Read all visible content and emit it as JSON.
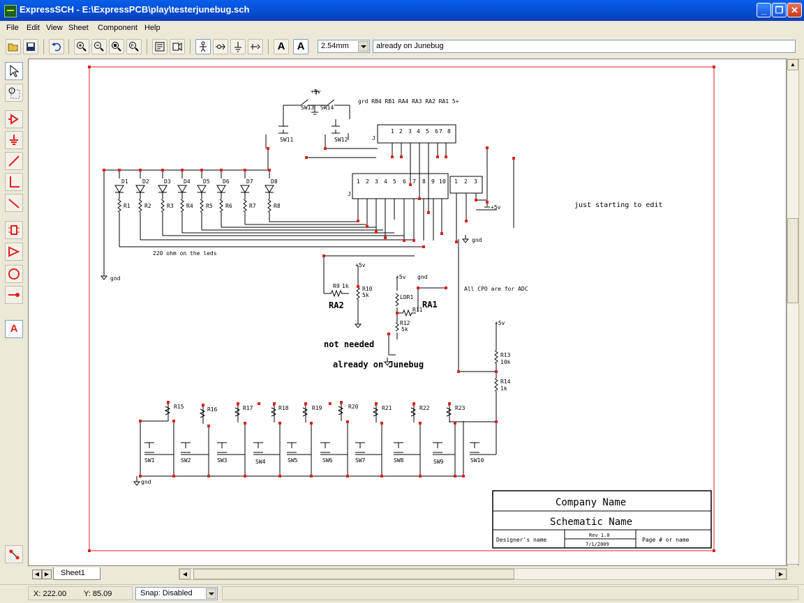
{
  "window": {
    "title": "ExpressSCH - E:\\ExpressPCB\\play\\testerjunebug.sch"
  },
  "menu": [
    "File",
    "Edit",
    "View",
    "Sheet",
    "Component",
    "Help"
  ],
  "toolbar": {
    "grid_value": "2.54mm",
    "text_value": "already on Junebug",
    "text_btn_1": "A",
    "text_btn_2": "A"
  },
  "left_tools": {
    "text_tool": "A"
  },
  "sheet_tab": "Sheet1",
  "status": {
    "x": "X: 222.00",
    "y": "Y: 85.09",
    "snap": "Snap: Disabled"
  },
  "schematic": {
    "switch_labels": [
      "SW13",
      "SW14",
      "SW11",
      "SW12"
    ],
    "port_header": "grd RB4 RB1 RA4 RA3 RA2 RA1 5+",
    "j_label": "J",
    "header_pins": [
      "1",
      "2",
      "3",
      "4",
      "5",
      "6",
      "7",
      "8"
    ],
    "header10_pins": [
      "1",
      "2",
      "3",
      "4",
      "5",
      "6",
      "7",
      "8",
      "9",
      "10"
    ],
    "header3_pins": [
      "1",
      "2",
      "3"
    ],
    "leds": [
      "D1",
      "D2",
      "D3",
      "D4",
      "D5",
      "D6",
      "D7",
      "D8"
    ],
    "resistors_led": [
      "R1",
      "R2",
      "R3",
      "R4",
      "R5",
      "R6",
      "R7",
      "R8"
    ],
    "gnd": "gnd",
    "plus5v": "+5v",
    "led_note": "220 ohm on the leds",
    "edit_note": "just starting to edit",
    "adc_note": "All CPO are for ADC",
    "r9": "R9",
    "r10": "R10",
    "v1k": "1k",
    "v5k": "5k",
    "v10k": "10k",
    "ra2": "RA2",
    "ra1": "RA1",
    "ldr": "LDR1",
    "r11": "R11",
    "r12": "R12",
    "not_needed": "not needed",
    "already": "already on Junebug",
    "r13": "R13",
    "r14": "R14",
    "resistors_bottom": [
      "R15",
      "R16",
      "R17",
      "R18",
      "R19",
      "R20",
      "R21",
      "R22",
      "R23"
    ],
    "switches_bottom": [
      "SW1",
      "SW2",
      "SW3",
      "SW4",
      "SW5",
      "SW6",
      "SW7",
      "SW8",
      "SW9",
      "SW10"
    ],
    "title_block": {
      "company": "Company Name",
      "schematic": "Schematic Name",
      "designer": "Designer's name",
      "rev": "Rev 1.0",
      "date": "7/1/2009",
      "page": "Page # or name"
    }
  }
}
